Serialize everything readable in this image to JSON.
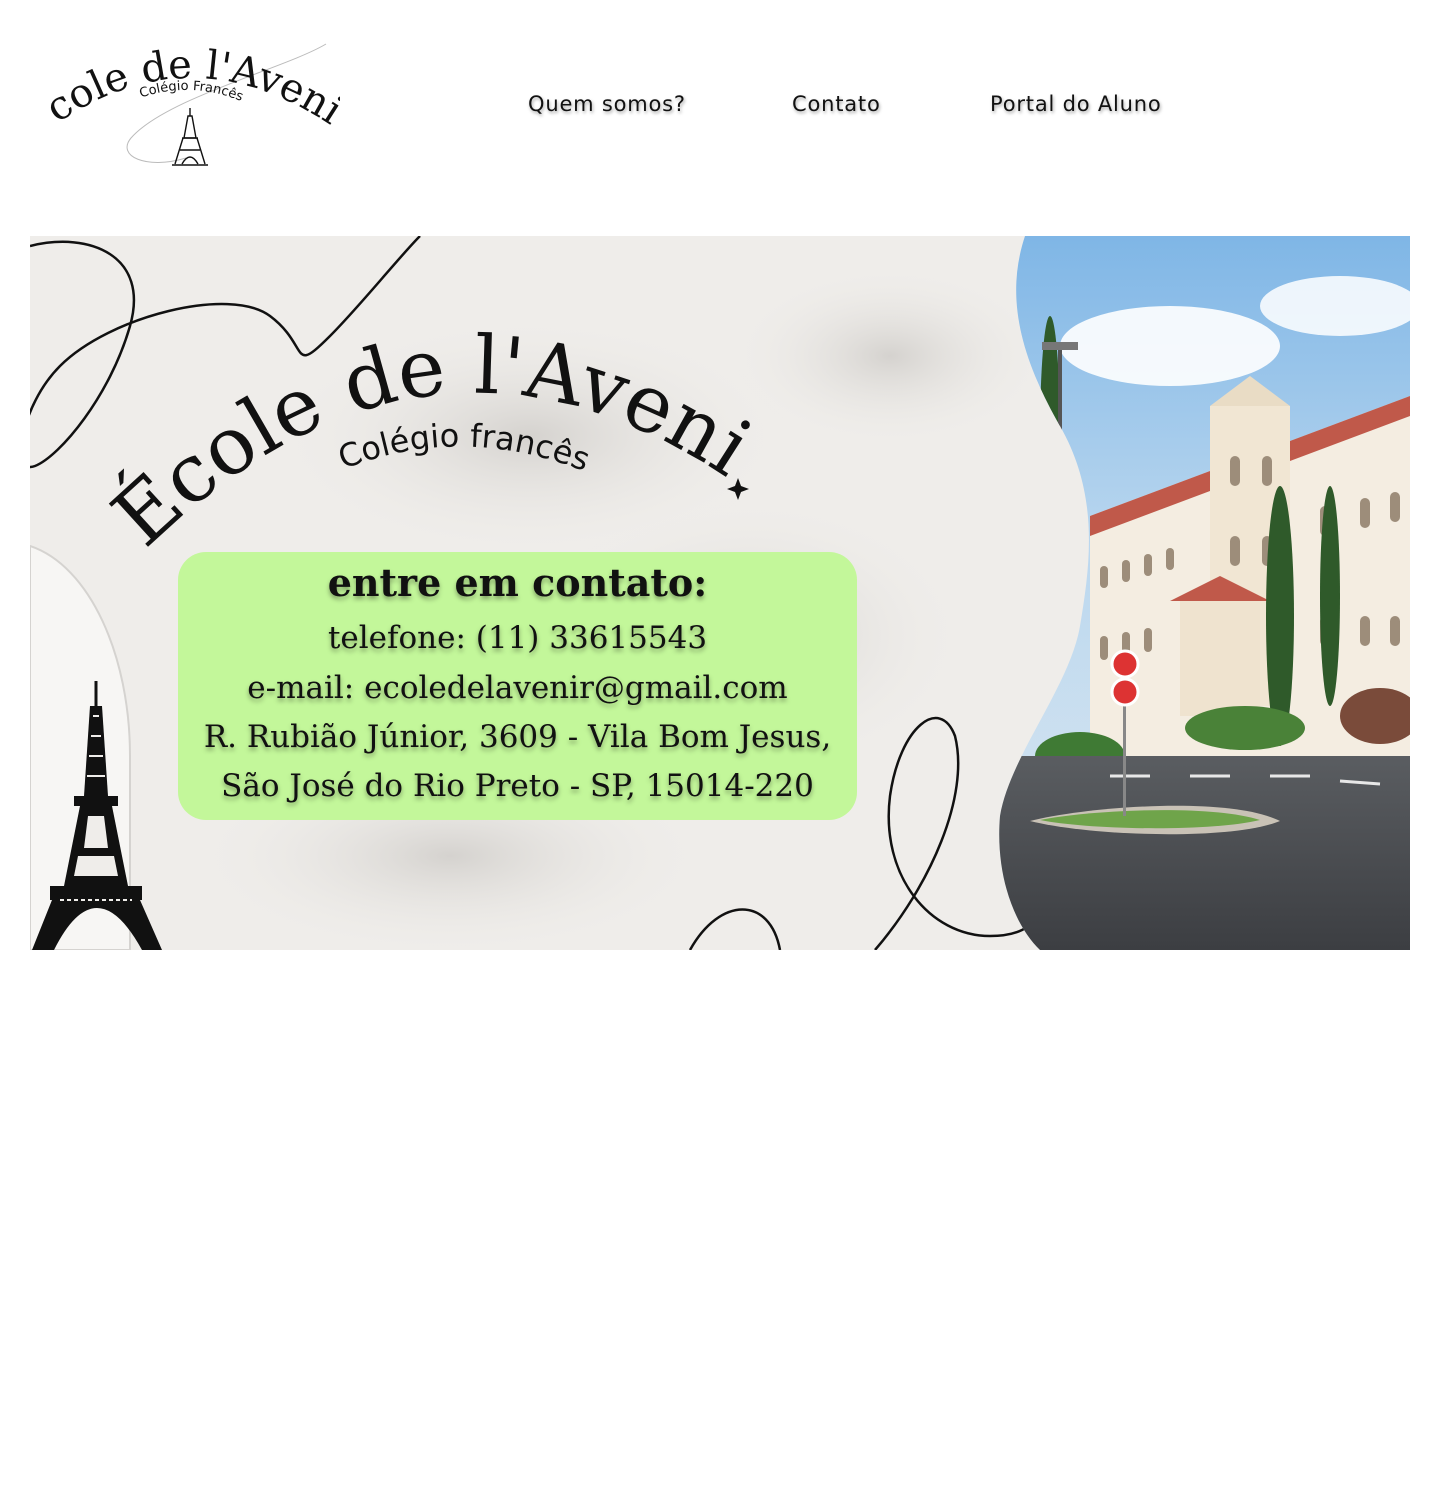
{
  "header": {
    "logo": {
      "title": "École de l'Avenir",
      "subtitle": "Colégio Francês"
    },
    "nav": [
      {
        "label": "Quem somos?"
      },
      {
        "label": "Contato"
      },
      {
        "label": "Portal do Aluno"
      }
    ]
  },
  "hero": {
    "brand_title": "École de l'Avenir",
    "brand_subtitle": "Colégio francês",
    "contact": {
      "heading": "entre em contato:",
      "phone": "telefone: (11) 33615543",
      "email": "e-mail: ecoledelavenir@gmail.com",
      "address_line1": "R. Rubião Júnior, 3609 - Vila Bom Jesus,",
      "address_line2": "São José do Rio Preto - SP, 15014-220"
    }
  },
  "colors": {
    "card_background": "#c3f79a",
    "paper_background": "#efedea",
    "text": "#111111"
  },
  "icons": [
    "eiffel-tower-icon",
    "eiffel-tower-logo-icon"
  ]
}
